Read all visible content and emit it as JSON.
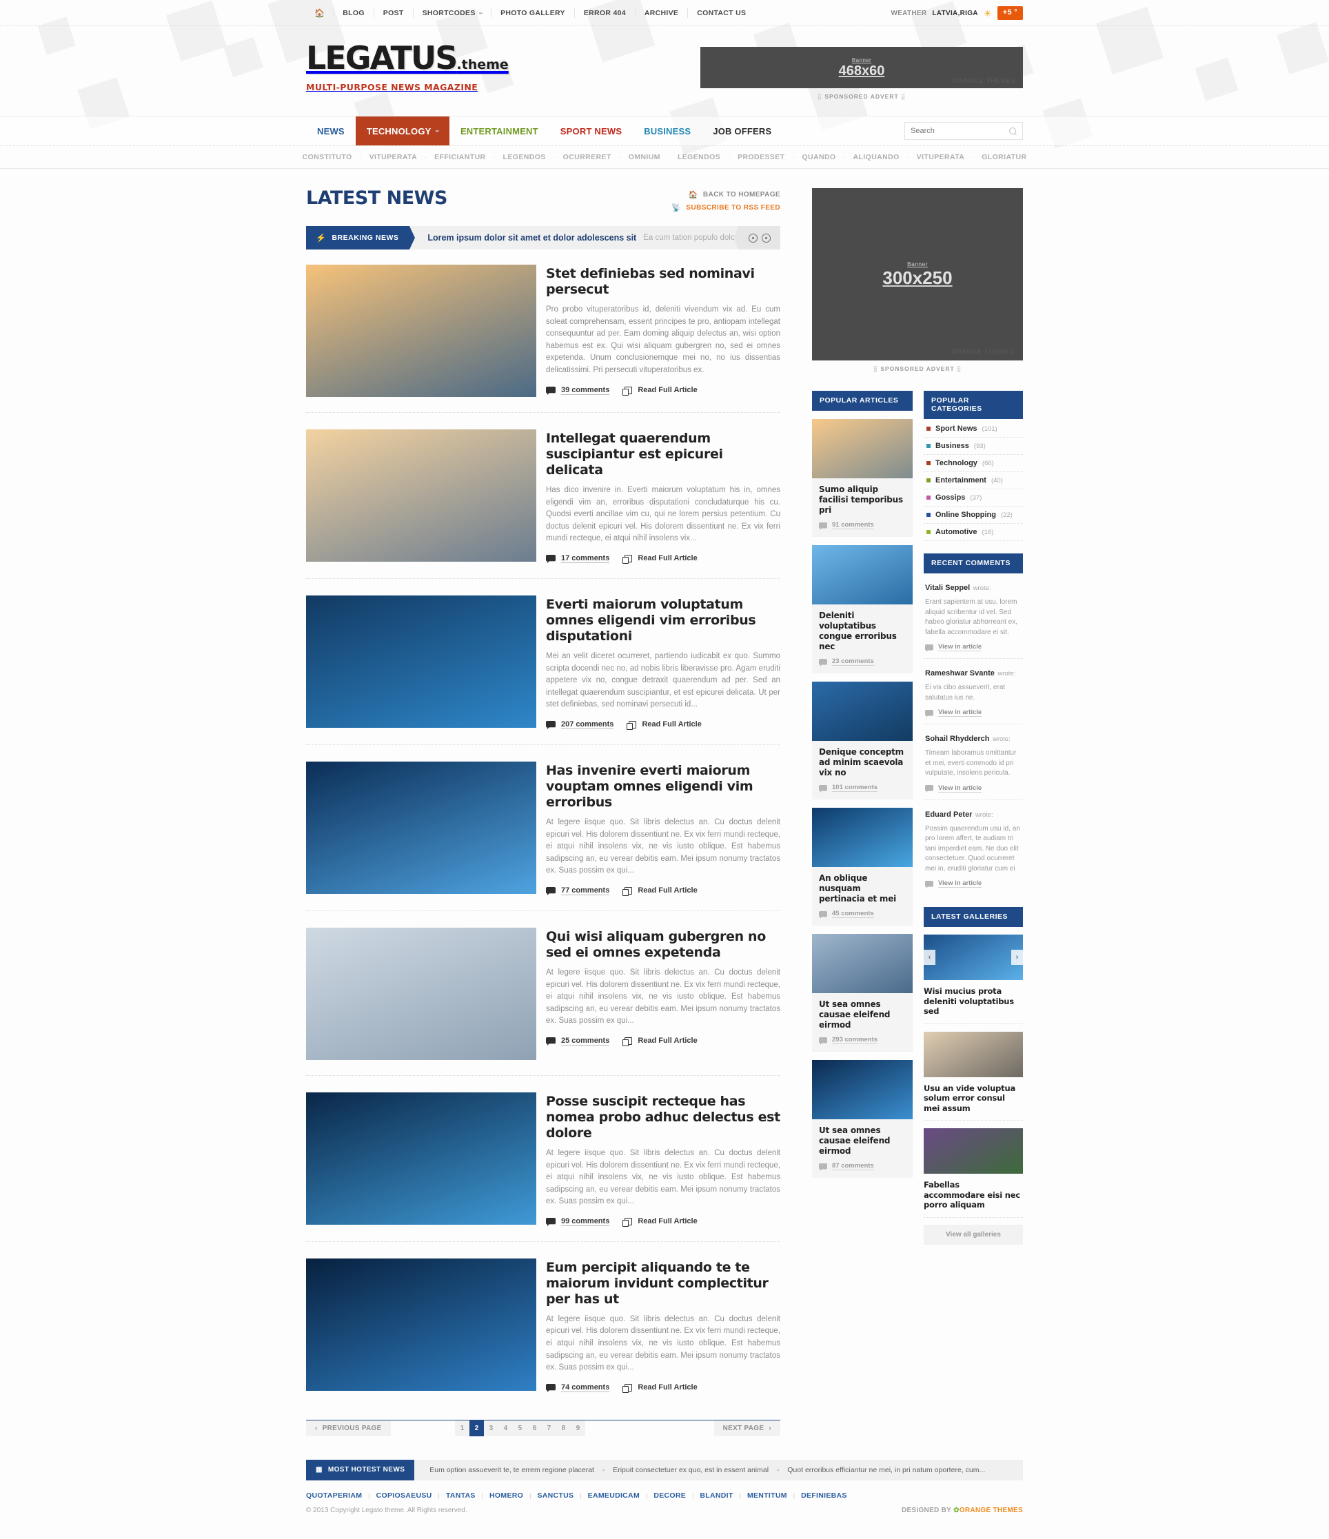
{
  "topbar": {
    "home_icon": "home-icon",
    "links": [
      "BLOG",
      "POST",
      "SHORTCODES",
      "PHOTO GALLERY",
      "ERROR 404",
      "ARCHIVE",
      "CONTACT US"
    ],
    "weather_label": "WEATHER",
    "weather_location": "LATVIA,RIGA",
    "weather_icon": "sun-icon",
    "temperature": "+5 °"
  },
  "logo": {
    "name": "LEGATUS",
    "suffix": ".theme",
    "tagline": "MULTI-PURPOSE NEWS MAGAZINE"
  },
  "header_banner": {
    "label": "Banner",
    "size": "468x60",
    "watermark": "ORANGE THEMES",
    "caption": "SPONSORED ADVERT"
  },
  "mainnav": [
    {
      "label": "NEWS",
      "color": "#2a5d9e",
      "active": false
    },
    {
      "label": "TECHNOLOGY",
      "color": "#ffffff",
      "active": true
    },
    {
      "label": "ENTERTAINMENT",
      "color": "#6f9a20",
      "active": false
    },
    {
      "label": "SPORT NEWS",
      "color": "#c0271b",
      "active": false
    },
    {
      "label": "BUSINESS",
      "color": "#2387b5",
      "active": false
    },
    {
      "label": "JOB OFFERS",
      "color": "#2b2b2b",
      "active": false
    }
  ],
  "search": {
    "placeholder": "Search",
    "value": "",
    "icon": "search-icon"
  },
  "subnav": [
    "CONSTITUTO",
    "VITUPERATA",
    "EFFICIANTUR",
    "LEGENDOS",
    "OCURRERET",
    "OMNIUM",
    "LEGENDOS",
    "PRODESSET",
    "QUANDO",
    "ALIQUANDO",
    "VITUPERATA",
    "GLORIATUR"
  ],
  "page": {
    "title": "LATEST NEWS",
    "back_link": "BACK TO HOMEPAGE",
    "rss_link": "SUBSCRIBE TO RSS FEED"
  },
  "breaking": {
    "tag": "BREAKING NEWS",
    "headline": "Lorem ipsum dolor sit amet et dolor adolescens sit",
    "excerpt": "Ea cum tation populo dolores..."
  },
  "articles": [
    {
      "title": "Stet definiebas sed nominavi persecut",
      "body": "Pro probo vituperatoribus id, deleniti vivendum vix ad. Eu cum soleat comprehensam, essent principes te pro, antiopam intellegat consequuntur ad per. Eam doming aliquip delectus an, wisi option habemus est ex. Qui wisi aliquam gubergren no, sed ei omnes expetenda. Unum conclusionemque mei no, no ius dissentias delicatissimi. Pri persecuti vituperatoribus ex.",
      "comments": "39 comments",
      "read": "Read Full Article",
      "img_from": "#f6c27a",
      "img_to": "#4b6a86",
      "tall": true
    },
    {
      "title": "Intellegat quaerendum suscipiantur est epicurei delicata",
      "body": "Has dico invenire in. Everti maiorum voluptatum his in, omnes eligendi vim an, erroribus disputationi concludaturque his cu. Quodsi everti ancillae vim cu, qui ne lorem persius petentium. Cu doctus delenit epicuri vel. His dolorem dissentiunt ne. Ex vix ferri mundi recteque, ei atqui nihil insolens vix...",
      "comments": "17 comments",
      "read": "Read Full Article",
      "img_from": "#f3d2a0",
      "img_to": "#6b7d90",
      "tall": true
    },
    {
      "title": "Everti maiorum voluptatum omnes eligendi vim erroribus disputationi",
      "body": "Mei an velit diceret ocurreret, partiendo iudicabit ex quo. Summo scripta docendi nec no, ad nobis libris liberavisse pro. Agam eruditi appetere vix no, congue detraxit quaerendum ad per. Sed an intellegat quaerendum suscipiantur, et est epicurei delicata. Ut per stet definiebas, sed nominavi persecuti id...",
      "comments": "207 comments",
      "read": "Read Full Article",
      "img_from": "#123a63",
      "img_to": "#2e87c9",
      "tall": true
    },
    {
      "title": "Has invenire everti maiorum vouptam omnes eligendi vim erroribus",
      "body": "At legere iisque quo. Sit libris delectus an. Cu doctus delenit epicuri vel. His dolorem dissentiunt ne. Ex vix ferri mundi recteque, ei atqui nihil insolens vix, ne vis iusto oblique. Est habemus sadipscing an, eu verear debitis eam. Mei ipsum nonumy tractatos ex. Suas possim ex qui...",
      "comments": "77 comments",
      "read": "Read Full Article",
      "img_from": "#0b2e57",
      "img_to": "#4fa3e0",
      "tall": true
    },
    {
      "title": "Qui wisi aliquam gubergren no sed ei omnes expetenda",
      "body": "At legere iisque quo. Sit libris delectus an. Cu doctus delenit epicuri vel. His dolorem dissentiunt ne. Ex vix ferri mundi recteque, ei atqui nihil insolens vix, ne vis iusto oblique. Est habemus sadipscing an, eu verear debitis eam. Mei ipsum nonumy tractatos ex. Suas possim ex qui...",
      "comments": "25 comments",
      "read": "Read Full Article",
      "img_from": "#cfd9e3",
      "img_to": "#8fa2b4",
      "tall": true
    },
    {
      "title": "Posse suscipit recteque has nomea probo adhuc delectus est dolore",
      "body": "At legere iisque quo. Sit libris delectus an. Cu doctus delenit epicuri vel. His dolorem dissentiunt ne. Ex vix ferri mundi recteque, ei atqui nihil insolens vix, ne vis iusto oblique. Est habemus sadipscing an, eu verear debitis eam. Mei ipsum nonumy tractatos ex. Suas possim ex qui...",
      "comments": "99 comments",
      "read": "Read Full Article",
      "img_from": "#0a2748",
      "img_to": "#3f9ad6",
      "tall": true
    },
    {
      "title": "Eum percipit aliquando te te maiorum invidunt complectitur per has ut",
      "body": "At legere iisque quo. Sit libris delectus an. Cu doctus delenit epicuri vel. His dolorem dissentiunt ne. Ex vix ferri mundi recteque, ei atqui nihil insolens vix, ne vis iusto oblique. Est habemus sadipscing an, eu verear debitis eam. Mei ipsum nonumy tractatos ex. Suas possim ex qui...",
      "comments": "74 comments",
      "read": "Read Full Article",
      "img_from": "#08213f",
      "img_to": "#2f7fc4",
      "tall": true
    }
  ],
  "sidebar": {
    "banner": {
      "label": "Banner",
      "size": "300x250",
      "watermark": "ORANGE THEMES",
      "caption": "SPONSORED ADVERT"
    },
    "popular_articles": {
      "title": "POPULAR ARTICLES",
      "items": [
        {
          "title": "Sumo aliquip facilisi temporibus pri",
          "comments": "91 comments",
          "from": "#f7c98b",
          "to": "#7e8c8f"
        },
        {
          "title": "Deleniti voluptatibus congue erroribus nec",
          "comments": "23 comments",
          "from": "#6fb7e8",
          "to": "#2a6ca5"
        },
        {
          "title": "Denique conceptm ad minim scaevola vix no",
          "comments": "101 comments",
          "from": "#2b6aa8",
          "to": "#123b63"
        },
        {
          "title": "An oblique nusquam pertinacia et mei",
          "comments": "45 comments",
          "from": "#0e3a6b",
          "to": "#49a7e2"
        },
        {
          "title": "Ut sea omnes causae eleifend eirmod",
          "comments": "293 comments",
          "from": "#9fb6cc",
          "to": "#4a6a8c"
        },
        {
          "title": "Ut sea omnes causae eleifend eirmod",
          "comments": "87 comments",
          "from": "#0b2a50",
          "to": "#3b8fd0"
        }
      ]
    },
    "popular_categories": {
      "title": "POPULAR CATEGORIES",
      "items": [
        {
          "label": "Sport News",
          "count": "(101)",
          "color": "#b03a2e"
        },
        {
          "label": "Business",
          "count": "(93)",
          "color": "#2d98b5"
        },
        {
          "label": "Technology",
          "count": "(66)",
          "color": "#a8411f"
        },
        {
          "label": "Entertainment",
          "count": "(40)",
          "color": "#7ba226"
        },
        {
          "label": "Gossips",
          "count": "(37)",
          "color": "#c159a8"
        },
        {
          "label": "Online Shopping",
          "count": "(22)",
          "color": "#2a4f9e"
        },
        {
          "label": "Automotive",
          "count": "(16)",
          "color": "#8db32b"
        }
      ]
    },
    "recent_comments": {
      "title": "RECENT COMMENTS",
      "wrote": "wrote:",
      "view": "View in article",
      "items": [
        {
          "author": "Vitali Seppel",
          "text": "Erant sapientem at usu, lorem aliquid scribentur id vel. Sed habeo gloriatur abhorreant ex, fabella accommodare ei sit."
        },
        {
          "author": "Rameshwar Svante",
          "text": "Ei vis cibo assueverit, erat salutatus ius ne."
        },
        {
          "author": "Sohail Rhydderch",
          "text": "Timeam laboramus omittantur et mei, everti commodo id pri vulputate, insolens pericula."
        },
        {
          "author": "Eduard Peter",
          "text": "Possim quaerendum usu id, an pro lorem affert, te audiam tri tani imperdiet eam. Ne duo elit consectetuer. Quod ocurreret mei in, eruditi gloriatur cum ei"
        }
      ]
    },
    "latest_galleries": {
      "title": "LATEST GALLERIES",
      "prev_icon": "chevron-left-icon",
      "next_icon": "chevron-right-icon",
      "view_all": "View all galleries",
      "items": [
        {
          "title": "Wisi mucius prota deleniti voluptatibus sed",
          "from": "#1c4f8a",
          "to": "#5bb0e8",
          "slider": true
        },
        {
          "title": "Usu an vide voluptua solum error consul mei assum",
          "from": "#e0cdb2",
          "to": "#6e6a63",
          "slider": false
        },
        {
          "title": "Fabellas accommodare eisi nec porro aliquam",
          "from": "#6b4a86",
          "to": "#3d6b3a",
          "slider": false
        }
      ]
    }
  },
  "pagination": {
    "prev": "PREVIOUS PAGE",
    "next": "NEXT PAGE",
    "pages": [
      "1",
      "2",
      "3",
      "4",
      "5",
      "6",
      "7",
      "8",
      "9"
    ],
    "current": "2"
  },
  "footer": {
    "hotest_tag": "MOST HOTEST NEWS",
    "hotest_items": [
      "Eum option assueverit te, te errem regione placerat",
      "Eripuit consectetuer ex quo, est in essent animal",
      "Quot erroribus efficiantur ne mei, in pri natum oportere, cum..."
    ],
    "links": [
      "QUOTAPERIAM",
      "COPIOSAEUSU",
      "TANTAS",
      "HOMERO",
      "SANCTUS",
      "EAMEUDICAM",
      "DECORE",
      "BLANDIT",
      "MENTITUM",
      "DEFINIEBAS"
    ],
    "copyright": "© 2013 Copyright Legato theme. All Rights reserved.",
    "designed_by": "DESIGNED BY",
    "designer": "ORANGE THEMES"
  }
}
